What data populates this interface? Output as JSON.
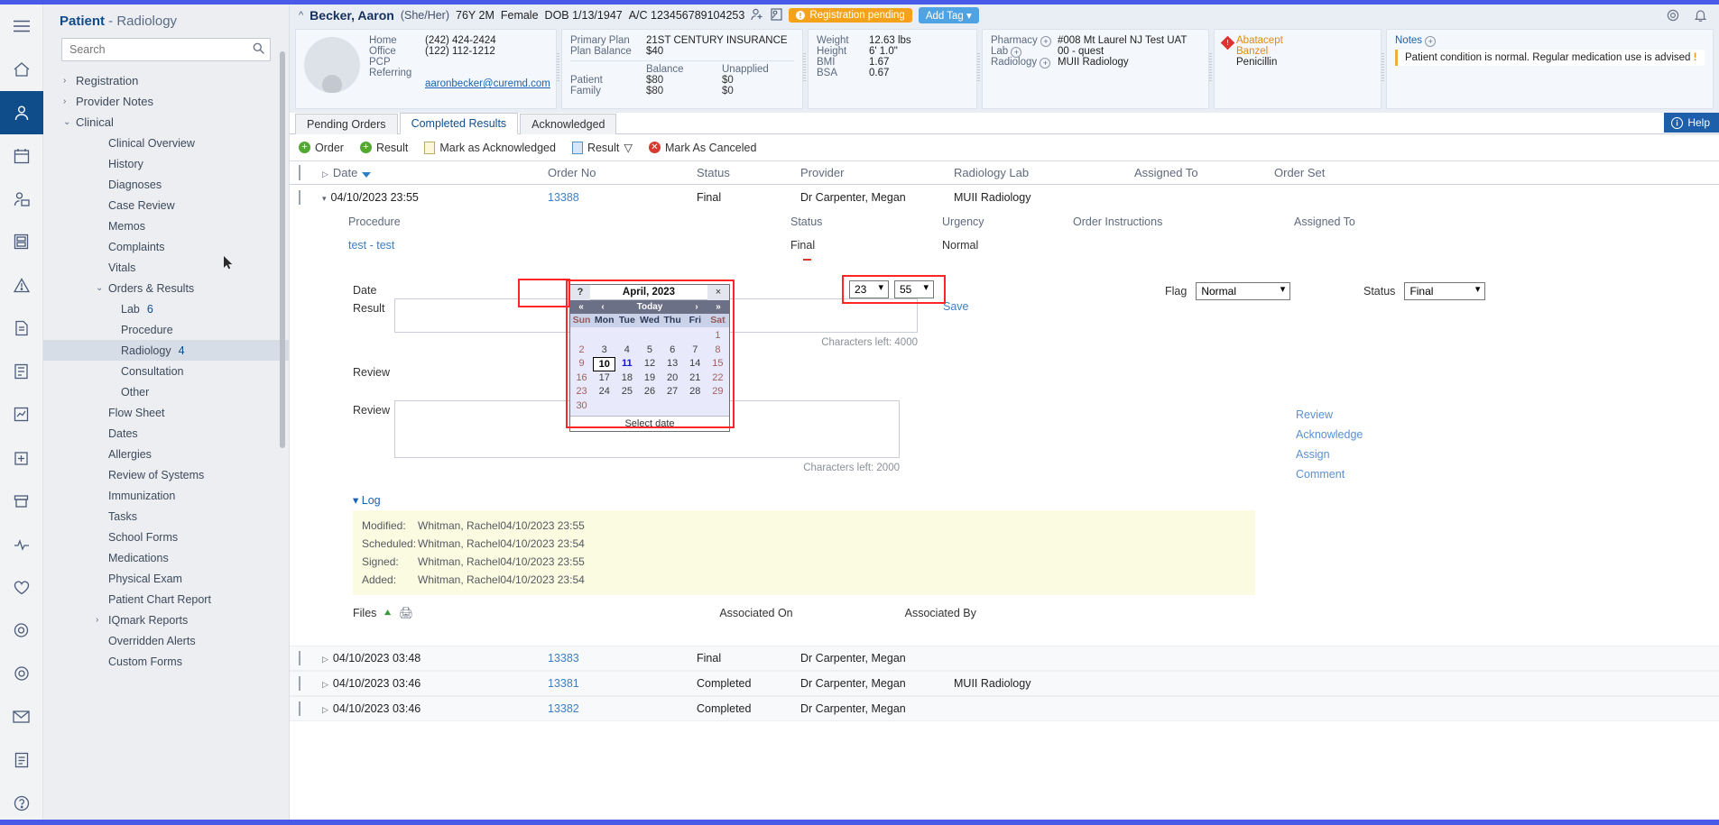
{
  "nav": {
    "title_main": "Patient",
    "title_sub": " - Radiology",
    "search_placeholder": "Search",
    "search_value": "",
    "items": [
      {
        "label": "Registration",
        "level": 1,
        "caret": "›",
        "selected": false
      },
      {
        "label": "Provider Notes",
        "level": 1,
        "caret": "›",
        "selected": false
      },
      {
        "label": "Clinical",
        "level": 1,
        "caret": "⌄",
        "selected": false
      },
      {
        "label": "Clinical Overview",
        "level": 2,
        "caret": "",
        "selected": false
      },
      {
        "label": "History",
        "level": 2,
        "caret": "",
        "selected": false
      },
      {
        "label": "Diagnoses",
        "level": 2,
        "caret": "",
        "selected": false
      },
      {
        "label": "Case Review",
        "level": 2,
        "caret": "",
        "selected": false
      },
      {
        "label": "Memos",
        "level": 2,
        "caret": "",
        "selected": false
      },
      {
        "label": "Complaints",
        "level": 2,
        "caret": "",
        "selected": false
      },
      {
        "label": "Vitals",
        "level": 2,
        "caret": "",
        "selected": false
      },
      {
        "label": "Orders & Results",
        "level": 2,
        "caret": "⌄",
        "selected": false
      },
      {
        "label": "Lab",
        "level": 3,
        "caret": "",
        "selected": false,
        "count": "6"
      },
      {
        "label": "Procedure",
        "level": 3,
        "caret": "",
        "selected": false
      },
      {
        "label": "Radiology",
        "level": 3,
        "caret": "",
        "selected": true,
        "count": "4"
      },
      {
        "label": "Consultation",
        "level": 3,
        "caret": "",
        "selected": false
      },
      {
        "label": "Other",
        "level": 3,
        "caret": "",
        "selected": false
      },
      {
        "label": "Flow Sheet",
        "level": 2,
        "caret": "",
        "selected": false
      },
      {
        "label": "Dates",
        "level": 2,
        "caret": "",
        "selected": false
      },
      {
        "label": "Allergies",
        "level": 2,
        "caret": "",
        "selected": false
      },
      {
        "label": "Review of Systems",
        "level": 2,
        "caret": "",
        "selected": false
      },
      {
        "label": "Immunization",
        "level": 2,
        "caret": "",
        "selected": false
      },
      {
        "label": "Tasks",
        "level": 2,
        "caret": "",
        "selected": false
      },
      {
        "label": "School Forms",
        "level": 2,
        "caret": "",
        "selected": false
      },
      {
        "label": "Medications",
        "level": 2,
        "caret": "",
        "selected": false
      },
      {
        "label": "Physical Exam",
        "level": 2,
        "caret": "",
        "selected": false
      },
      {
        "label": "Patient Chart Report",
        "level": 2,
        "caret": "",
        "selected": false
      },
      {
        "label": "IQmark Reports",
        "level": 2,
        "caret": "›",
        "selected": false
      },
      {
        "label": "Overridden Alerts",
        "level": 2,
        "caret": "",
        "selected": false
      },
      {
        "label": "Custom Forms",
        "level": 2,
        "caret": "",
        "selected": false
      }
    ]
  },
  "patient": {
    "name": "Becker, Aaron",
    "pronouns": "(She/Her)",
    "age": "76Y 2M",
    "gender": "Female",
    "dob": "DOB 1/13/1947",
    "account": "A/C 123456789104253",
    "registration_badge": "Registration pending",
    "add_tag": "Add Tag",
    "contact": [
      {
        "k": "Home",
        "v": "(242) 424-2424"
      },
      {
        "k": "Office",
        "v": "(122) 112-1212"
      },
      {
        "k": "PCP",
        "v": ""
      },
      {
        "k": "Referring",
        "v": ""
      }
    ],
    "email": "aaronbecker@curemd.com",
    "insurance": {
      "primary_plan_label": "Primary Plan",
      "primary_plan_value": "21ST CENTURY INSURANCE",
      "plan_balance_label": "Plan Balance",
      "plan_balance_value": "$40",
      "col_balance": "Balance",
      "col_unapplied": "Unapplied",
      "rows": [
        {
          "k": "Patient",
          "balance": "$80",
          "unapplied": "$0"
        },
        {
          "k": "Family",
          "balance": "$80",
          "unapplied": "$0"
        }
      ]
    },
    "vitals": [
      {
        "k": "Weight",
        "v": "12.63 lbs"
      },
      {
        "k": "Height",
        "v": "6' 1.0\""
      },
      {
        "k": "BMI",
        "v": "1.67"
      },
      {
        "k": "BSA",
        "v": "0.67"
      }
    ],
    "facilities": [
      {
        "k": "Pharmacy",
        "v": "#008 Mt Laurel NJ Test UAT"
      },
      {
        "k": "Lab",
        "v": "00 - quest"
      },
      {
        "k": "Radiology",
        "v": "MUII Radiology"
      }
    ],
    "allergies": [
      "Abatacept",
      "Banzel",
      "Penicillin"
    ],
    "notes_label": "Notes",
    "note_text": "Patient condition is normal. Regular medication use is advised"
  },
  "main": {
    "tabs": [
      {
        "label": "Pending Orders",
        "active": false
      },
      {
        "label": "Completed Results",
        "active": true
      },
      {
        "label": "Acknowledged",
        "active": false
      }
    ],
    "toolbar": [
      {
        "label": "Order",
        "icon": "plus-circle-green"
      },
      {
        "label": "Result",
        "icon": "plus-circle-green"
      },
      {
        "label": "Mark as Acknowledged",
        "icon": "document-icon"
      },
      {
        "label": "Result",
        "icon": "book-icon",
        "caret": "▽"
      },
      {
        "label": "Mark As Canceled",
        "icon": "cancel-circle-red"
      }
    ],
    "help_label": "Help",
    "columns": {
      "date": "Date",
      "order_no": "Order No",
      "status": "Status",
      "provider": "Provider",
      "radiology_lab": "Radiology Lab",
      "assigned_to": "Assigned To",
      "order_set": "Order Set"
    },
    "expanded_row": {
      "date": "04/10/2023 23:55",
      "order_no": "13388",
      "status": "Final",
      "provider": "Dr Carpenter, Megan",
      "radiology_lab": "MUII Radiology",
      "assigned_to": "",
      "order_set": ""
    },
    "detail_headers": {
      "procedure": "Procedure",
      "status": "Status",
      "urgency": "Urgency",
      "order_instructions": "Order Instructions",
      "assigned_to": "Assigned To"
    },
    "detail_values": {
      "procedure": "test - test",
      "status": "Final",
      "urgency": "Normal",
      "order_instructions": "",
      "assigned_to": ""
    },
    "form": {
      "date_label": "Date",
      "result_label": "Result",
      "review_label1": "Review",
      "review_label2": "Review",
      "hour_value": "23",
      "minute_value": "55",
      "flag_label": "Flag",
      "flag_value": "Normal",
      "status_label": "Status",
      "status_value": "Final",
      "save_label": "Save",
      "result_chars_left": "Characters left: 4000",
      "review_chars_left": "Characters left: 2000",
      "result_value": "",
      "review_value": ""
    },
    "actions": [
      "Review",
      "Acknowledge",
      "Assign",
      "Comment"
    ],
    "log": {
      "title": "Log",
      "rows": [
        {
          "k": "Modified:",
          "v": "Whitman, Rachel04/10/2023 23:55"
        },
        {
          "k": "Scheduled:",
          "v": "Whitman, Rachel04/10/2023 23:54"
        },
        {
          "k": "Signed:",
          "v": "Whitman, Rachel04/10/2023 23:55"
        },
        {
          "k": "Added:",
          "v": "Whitman, Rachel04/10/2023 23:54"
        }
      ]
    },
    "files": {
      "label": "Files",
      "associated_on": "Associated On",
      "associated_by": "Associated By"
    },
    "other_rows": [
      {
        "date": "04/10/2023 03:48",
        "order_no": "13383",
        "status": "Final",
        "provider": "Dr Carpenter, Megan",
        "lab": ""
      },
      {
        "date": "04/10/2023 03:46",
        "order_no": "13381",
        "status": "Completed",
        "provider": "Dr Carpenter, Megan",
        "lab": "MUII Radiology"
      },
      {
        "date": "04/10/2023 03:46",
        "order_no": "13382",
        "status": "Completed",
        "provider": "Dr Carpenter, Megan",
        "lab": ""
      }
    ]
  },
  "calendar": {
    "help_glyph": "?",
    "month_year": "April, 2023",
    "close_glyph": "×",
    "prev_year": "«",
    "prev_month": "‹",
    "today_label": "Today",
    "next_month": "›",
    "next_year": "»",
    "dows": [
      "Sun",
      "Mon",
      "Tue",
      "Wed",
      "Thu",
      "Fri",
      "Sat"
    ],
    "weeks": [
      [
        "",
        "",
        "",
        "",
        "",
        "",
        "1"
      ],
      [
        "2",
        "3",
        "4",
        "5",
        "6",
        "7",
        "8"
      ],
      [
        "9",
        "10",
        "11",
        "12",
        "13",
        "14",
        "15"
      ],
      [
        "16",
        "17",
        "18",
        "19",
        "20",
        "21",
        "22"
      ],
      [
        "23",
        "24",
        "25",
        "26",
        "27",
        "28",
        "29"
      ],
      [
        "30",
        "",
        "",
        "",
        "",
        "",
        ""
      ]
    ],
    "today_day": "10",
    "selected_day": "11",
    "footer_label": "Select date"
  },
  "colors": {
    "accent_blue": "#1763b0",
    "brand_indigo": "#4a5ae8",
    "badge_orange": "#f5a21b",
    "tag_blue": "#4fa3e3",
    "highlight_red": "#fe2626",
    "log_yellow": "#fbfbe2"
  }
}
